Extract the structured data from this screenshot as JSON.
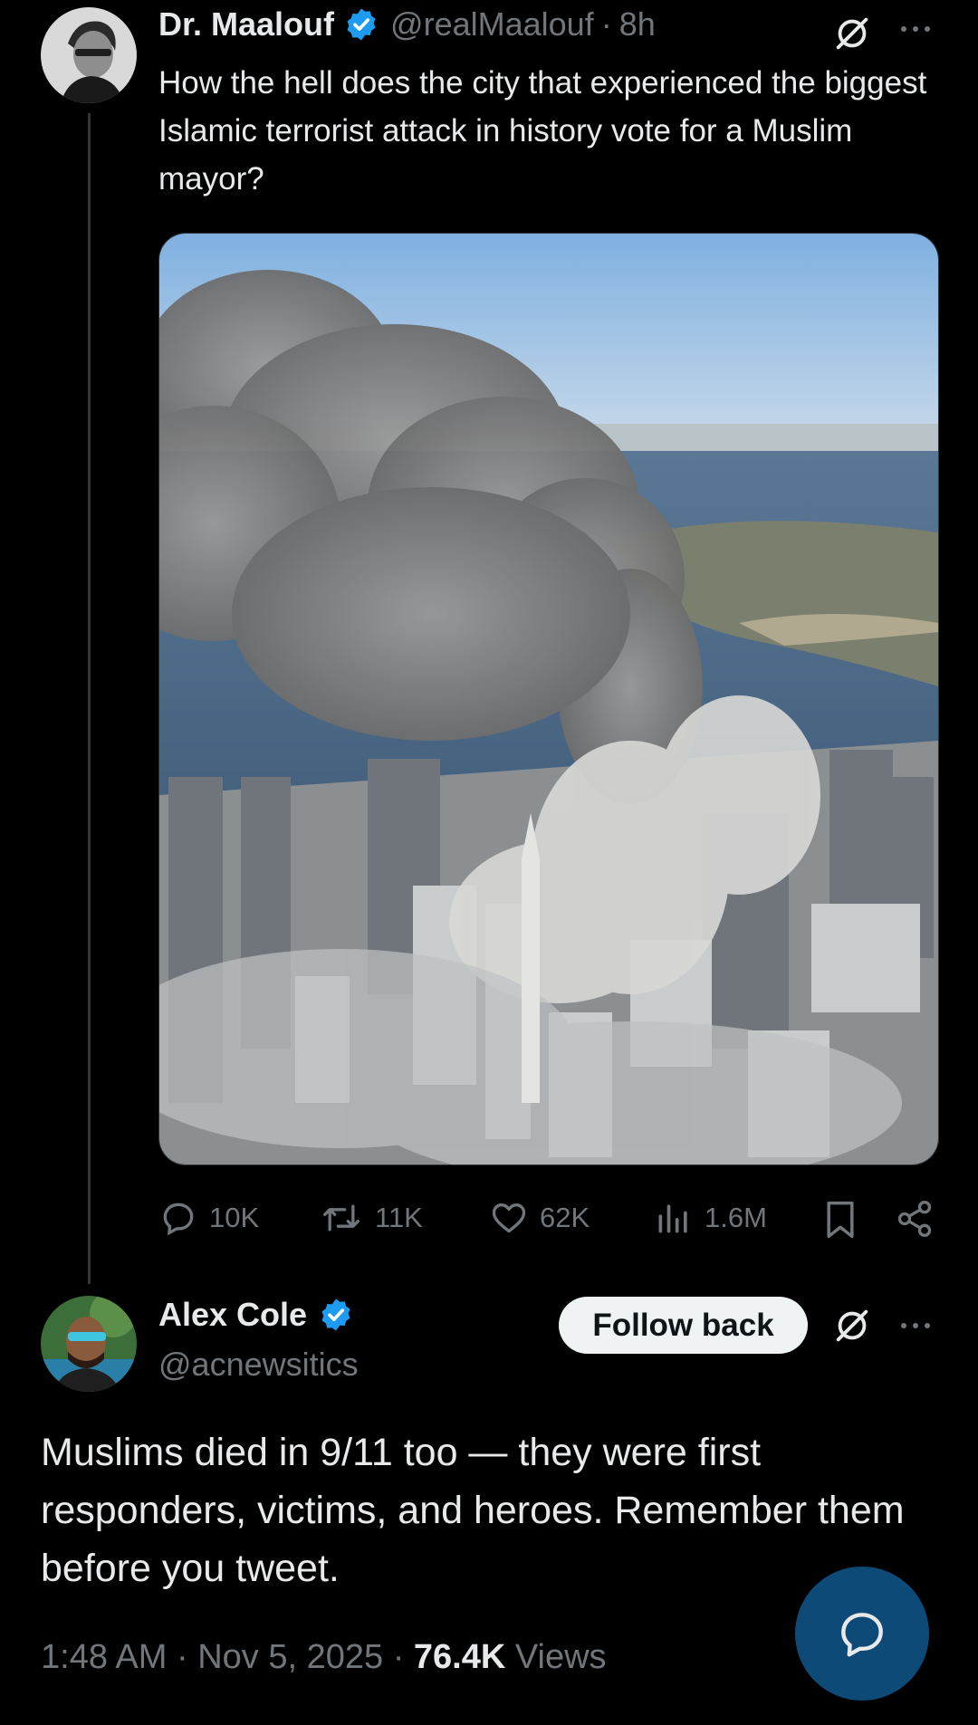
{
  "post": {
    "author_name": "Dr. Maalouf",
    "handle": "@realMaalouf",
    "time": "8h",
    "text": "How the hell does the city that experienced the biggest Islamic terrorist attack in history vote for a Muslim mayor?",
    "media_icon": "image-aerial-smoke-city",
    "stats": {
      "replies": "10K",
      "reposts": "11K",
      "likes": "62K",
      "views": "1.6M"
    }
  },
  "reply": {
    "author_name": "Alex Cole",
    "handle": "@acnewsitics",
    "follow_label": "Follow back",
    "text": "Muslims died in 9/11 too — they were first responders, victims, and heroes. Remember them before you tweet.",
    "time": "1:48 AM",
    "date": "Nov 5, 2025",
    "views_count": "76.4K",
    "views_label": "Views"
  },
  "separator": "·",
  "colors": {
    "background": "#000000",
    "text": "#e7e9ea",
    "muted": "#71767b",
    "verified": "#1d9bf0",
    "fab": "#0d4a78"
  },
  "icons": [
    "verified-badge-icon",
    "grok-icon",
    "more-icon",
    "reply-icon",
    "repost-icon",
    "like-icon",
    "views-icon",
    "bookmark-icon",
    "share-icon",
    "compose-reply-icon"
  ]
}
